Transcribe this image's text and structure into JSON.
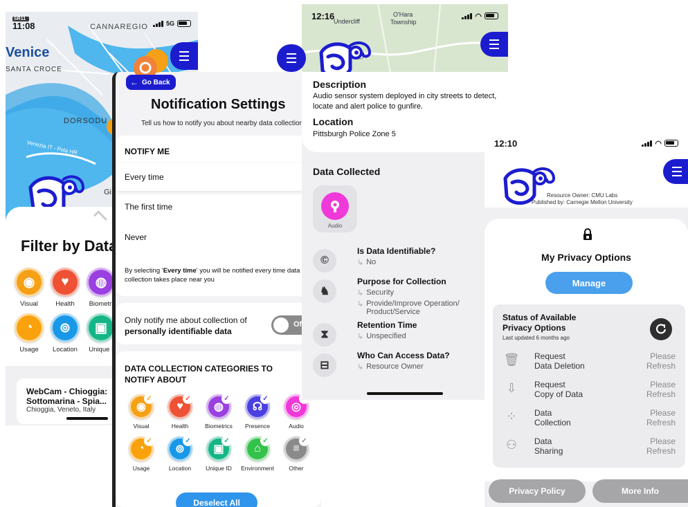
{
  "colors": {
    "blue": "#1c1ccf",
    "visual": "#f5a016",
    "health": "#ee5133",
    "biometrics": "#9a3fe0",
    "presence": "#4a3fe0",
    "audio": "#ef39d9",
    "usage": "#f9a20d",
    "location": "#1a98e8",
    "unique_id": "#16b587",
    "environment": "#34c24b",
    "other": "#8a8a8a",
    "manage": "#4aa0ec"
  },
  "map_screen": {
    "time": "11:08",
    "carrier": "SR11",
    "signal": "5G",
    "map_labels": [
      "CANNAREGIO",
      "Venice",
      "SANTA CROCE",
      "DORSODU",
      "Venezia IT - Pola HR",
      "Gi"
    ],
    "filter_title": "Filter by Data",
    "categories": [
      {
        "label": "Visual",
        "icon": "eye-icon"
      },
      {
        "label": "Health",
        "icon": "heart-icon"
      },
      {
        "label": "Biometri",
        "icon": "fingerprint-icon"
      },
      {
        "label": "Usage",
        "icon": "pie-icon"
      },
      {
        "label": "Location",
        "icon": "location-icon"
      },
      {
        "label": "Unique I",
        "icon": "id-card-icon"
      }
    ],
    "card_title_line1": "WebCam - Chioggia:",
    "card_title_line2": "Sottomarina - Spia...",
    "card_subtitle": "Chioggia, Veneto, Italy"
  },
  "notif_screen": {
    "go_back": "Go Back",
    "title": "Notification Settings",
    "subtitle": "Tell us how to notify you about nearby data collection",
    "notify_me": "NOTIFY ME",
    "options": [
      "Every time",
      "The first time",
      "Never"
    ],
    "desc_pre": "By selecting '",
    "desc_bold": "Every time",
    "desc_post": "' you will be notified every time data collection takes place near you",
    "only_notify_line1": "Only notify me about collection of",
    "only_notify_line2": "personally identifiable data",
    "toggle_label": "Off",
    "categories_title_line1": "DATA COLLECTION CATEGORIES TO",
    "categories_title_line2": "NOTIFY ABOUT",
    "categories": [
      {
        "label": "Visual",
        "icon": "eye-icon"
      },
      {
        "label": "Health",
        "icon": "heart-icon"
      },
      {
        "label": "Biometrics",
        "icon": "fingerprint-icon"
      },
      {
        "label": "Presence",
        "icon": "presence-icon"
      },
      {
        "label": "Audio",
        "icon": "microphone-icon"
      },
      {
        "label": "Usage",
        "icon": "pie-icon"
      },
      {
        "label": "Location",
        "icon": "location-icon"
      },
      {
        "label": "Unique ID",
        "icon": "id-card-icon"
      },
      {
        "label": "Environment",
        "icon": "environment-icon"
      },
      {
        "label": "Other",
        "icon": "other-icon"
      }
    ],
    "deselect_all": "Deselect All"
  },
  "detail_screen": {
    "time": "12:16",
    "map_labels": [
      "Undercliff",
      "O'Hara",
      "Township"
    ],
    "description_heading": "Description",
    "description_text": "Audio sensor system deployed in city streets to detect, locate and alert police to gunfire.",
    "location_heading": "Location",
    "location_text": "Pittsburgh Police Zone 5",
    "data_collected_heading": "Data Collected",
    "audio_label": "Audio",
    "rows": [
      {
        "title": "Is Data Identifiable?",
        "values": [
          "No"
        ],
        "icon": "identifiable-icon"
      },
      {
        "title": "Purpose for Collection",
        "values": [
          "Security",
          "Provide/Improve Operation/ Product/Service"
        ],
        "icon": "purpose-icon"
      },
      {
        "title": "Retention Time",
        "values": [
          "Unspecified"
        ],
        "icon": "hourglass-icon"
      },
      {
        "title": "Who Can Access Data?",
        "values": [
          "Resource Owner"
        ],
        "icon": "access-icon"
      }
    ]
  },
  "privacy_screen": {
    "time": "12:10",
    "resource_owner": "Resource Owner: CMU Labs",
    "published_by": "Published by: Carnegie Mellon University",
    "title": "My Privacy Options",
    "manage": "Manage",
    "status_title_line1": "Status of Available",
    "status_title_line2": "Privacy Options",
    "last_updated": "Last updated 6 months ago",
    "options": [
      {
        "line1": "Request",
        "line2": "Data Deletion",
        "status1": "Please",
        "status2": "Refresh",
        "icon": "trash-icon"
      },
      {
        "line1": "Request",
        "line2": "Copy of Data",
        "status1": "Please",
        "status2": "Refresh",
        "icon": "download-icon"
      },
      {
        "line1": "Data",
        "line2": "Collection",
        "status1": "Please",
        "status2": "Refresh",
        "icon": "collection-icon"
      },
      {
        "line1": "Data",
        "line2": "Sharing",
        "status1": "Please",
        "status2": "Refresh",
        "icon": "sharing-icon"
      }
    ],
    "privacy_policy": "Privacy Policy",
    "more_info": "More Info"
  }
}
